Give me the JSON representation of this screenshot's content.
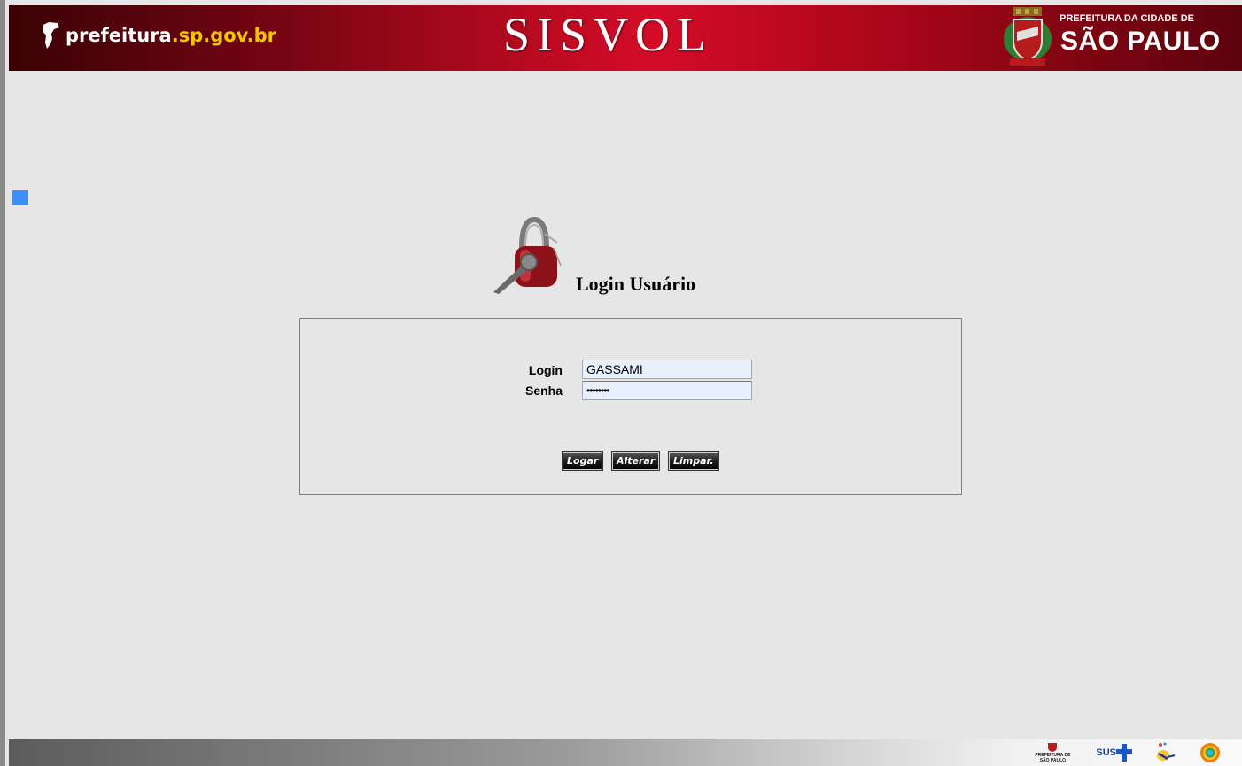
{
  "header": {
    "brand_prefix": "prefeitura",
    "brand_domain": ".sp.gov.br",
    "system_title": "SISVOL",
    "city_line1": "PREFEITURA DA CIDADE DE",
    "city_line2": "SÃO PAULO"
  },
  "login": {
    "heading": "Login Usuário",
    "login_label": "Login",
    "login_value": "GASSAMI",
    "password_label": "Senha",
    "password_value": "••••••••",
    "buttons": {
      "login": "Logar",
      "change": "Alterar",
      "clear": "Limpar."
    }
  },
  "footer": {
    "logo_prefeitura": "PREFEITURA DE SÃO PAULO",
    "logo_sus": "SUS"
  },
  "colors": {
    "banner_red": "#c00a22",
    "domain_yellow": "#f5c400",
    "page_background": "#e6e6e6",
    "marker_blue": "#3d8ef5"
  }
}
